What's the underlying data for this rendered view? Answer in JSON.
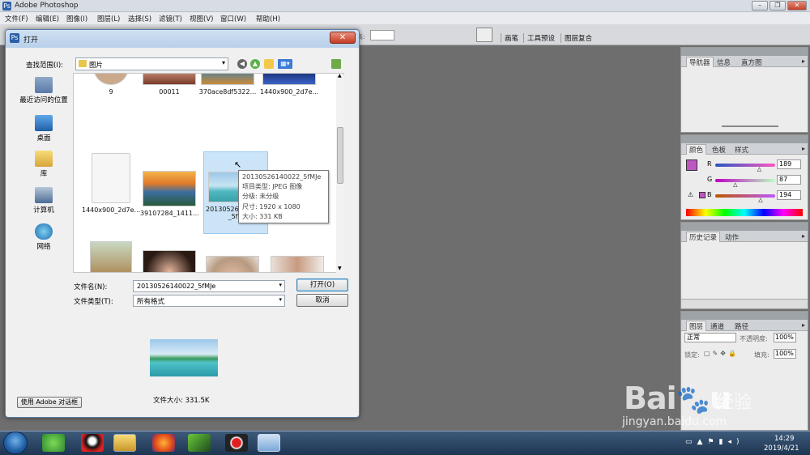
{
  "app": {
    "title": "Adobe Photoshop"
  },
  "menubar": [
    "文件(F)",
    "编辑(E)",
    "图像(I)",
    "图层(L)",
    "选择(S)",
    "滤镜(T)",
    "视图(V)",
    "窗口(W)",
    "帮助(H)"
  ],
  "options_bar": {
    "tabs": [
      "画笔",
      "工具预设",
      "图层复合"
    ],
    "field_label": "高:"
  },
  "dialog": {
    "title": "打开",
    "lookin_label": "查找范围(I):",
    "lookin_value": "图片",
    "places": [
      {
        "label": "最近访问的位置",
        "icon": "recent-places-icon"
      },
      {
        "label": "桌面",
        "icon": "desktop-icon"
      },
      {
        "label": "库",
        "icon": "libraries-icon"
      },
      {
        "label": "计算机",
        "icon": "computer-icon"
      },
      {
        "label": "网络",
        "icon": "network-icon"
      }
    ],
    "files_row1": [
      "9",
      "00011",
      "370ace8df5322...",
      "1440x900_2d7e..."
    ],
    "files_row2": [
      "1440x900_2d7e...",
      "39107284_1411...",
      "20130526",
      "",
      "_5fM"
    ],
    "tooltip": {
      "name": "20130526140022_5fMJe",
      "type": "项目类型: JPEG 图像",
      "rating": "分级: 未分级",
      "dimensions": "尺寸: 1920 x 1080",
      "size": "大小: 331 KB"
    },
    "filename_label": "文件名(N):",
    "filename_value": "20130526140022_5fMJe",
    "filetype_label": "文件类型(T):",
    "filetype_value": "所有格式",
    "open_button": "打开(O)",
    "cancel_button": "取消",
    "filesize": "文件大小: 331.5K",
    "adobe_dialog_button": "使用 Adobe 对话框"
  },
  "panels": {
    "navigator": {
      "tabs": [
        "导航器",
        "信息",
        "直方图"
      ]
    },
    "color": {
      "tabs": [
        "颜色",
        "色板",
        "样式"
      ],
      "r_label": "R",
      "g_label": "G",
      "b_label": "B",
      "r": "189",
      "g": "87",
      "b": "194",
      "r_level": 0.74,
      "g_level": 0.34,
      "b_level": 0.76,
      "foreground": "#bd57c2",
      "background": "#1fae3a"
    },
    "history": {
      "tabs": [
        "历史记录",
        "动作"
      ]
    },
    "layers": {
      "tabs": [
        "图层",
        "通道",
        "路径"
      ],
      "blend_mode": "正常",
      "opacity_label": "不透明度:",
      "opacity": "100%",
      "lock_label": "锁定:",
      "fill_label": "填充:",
      "fill": "100%"
    }
  },
  "taskbar": {
    "time": "14:29",
    "date": "2019/4/21"
  },
  "watermark": {
    "brand": "Bai",
    "brand_end": "u",
    "cn": "经验",
    "url": "jingyan.baidu.com"
  }
}
